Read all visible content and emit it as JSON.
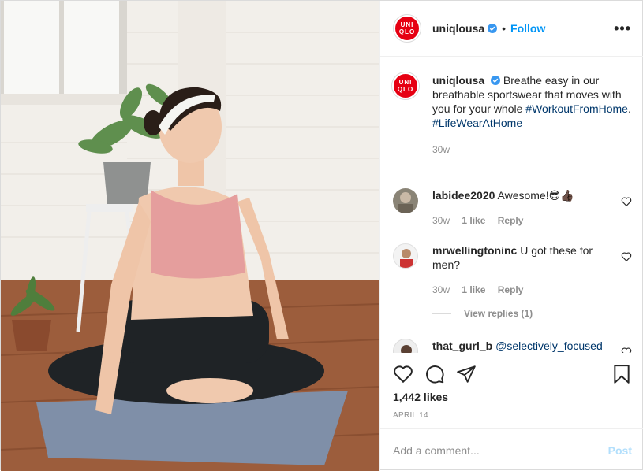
{
  "post": {
    "username": "uniqlousa",
    "follow_label": "Follow",
    "dot": "•",
    "more": "•••",
    "logo_line1": "UNI",
    "logo_line2": "QLO"
  },
  "caption": {
    "username": "uniqlousa",
    "text": "Breathe easy in our breathable sportswear that moves with you for your whole",
    "hashtag1": "#WorkoutFromHome",
    "dot": ".",
    "hashtag2": "#LifeWearAtHome",
    "age": "30w"
  },
  "comments": [
    {
      "username": "labidee2020",
      "text": "Awesome!😎👍🏿",
      "age": "30w",
      "likes": "1 like",
      "reply": "Reply"
    },
    {
      "username": "mrwellingtoninc",
      "text": "U got these for men?",
      "age": "30w",
      "likes": "1 like",
      "reply": "Reply"
    },
    {
      "username": "that_gurl_b",
      "text": "@selectively_focused"
    }
  ],
  "view_replies": "View replies (1)",
  "likes": "1,442 likes",
  "date": "APRIL 14",
  "comment_box": {
    "placeholder": "Add a comment...",
    "post_label": "Post"
  },
  "colors": {
    "accent": "#0095f6",
    "brand": "#e60012",
    "hashtag": "#00376b",
    "muted": "#8e8e8e"
  },
  "icons": [
    "verified-badge-icon",
    "more-options-icon",
    "heart-icon",
    "comment-icon",
    "share-icon",
    "bookmark-icon"
  ]
}
